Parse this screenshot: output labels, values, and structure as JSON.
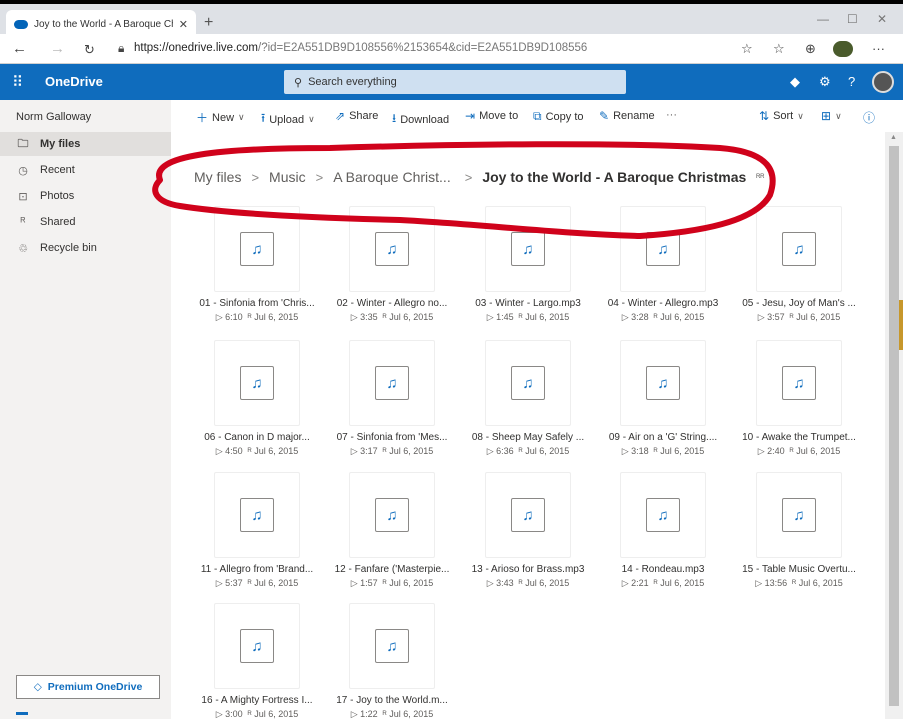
{
  "browser": {
    "tab_title": "Joy to the World - A Baroque Ch",
    "url_host": "https://onedrive.live.com",
    "url_rest": "/?id=E2A551DB9D108556%2153654&cid=E2A551DB9D108556"
  },
  "header": {
    "brand": "OneDrive",
    "search_placeholder": "Search everything"
  },
  "leftnav": {
    "user": "Norm Galloway",
    "items": [
      {
        "label": "My files",
        "icon": "folder-icon",
        "glyph": "🗀"
      },
      {
        "label": "Recent",
        "icon": "clock-icon",
        "glyph": "◷"
      },
      {
        "label": "Photos",
        "icon": "photo-icon",
        "glyph": "⊡"
      },
      {
        "label": "Shared",
        "icon": "people-icon",
        "glyph": "ᴿ"
      },
      {
        "label": "Recycle bin",
        "icon": "trash-icon",
        "glyph": "♲"
      }
    ],
    "premium": "Premium OneDrive"
  },
  "commands": {
    "new": "New",
    "upload": "Upload",
    "share": "Share",
    "download": "Download",
    "move_to": "Move to",
    "copy_to": "Copy to",
    "rename": "Rename",
    "more": "···",
    "sort": "Sort"
  },
  "breadcrumb": {
    "items": [
      "My files",
      "Music",
      "A Baroque Christ...",
      "Joy to the World - A Baroque Christmas"
    ]
  },
  "files": [
    {
      "name": "01 - Sinfonia from 'Chris...",
      "duration": "6:10",
      "date": "Jul 6, 2015"
    },
    {
      "name": "02 - Winter - Allegro no...",
      "duration": "3:35",
      "date": "Jul 6, 2015"
    },
    {
      "name": "03 - Winter - Largo.mp3",
      "duration": "1:45",
      "date": "Jul 6, 2015"
    },
    {
      "name": "04 - Winter - Allegro.mp3",
      "duration": "3:28",
      "date": "Jul 6, 2015"
    },
    {
      "name": "05 - Jesu, Joy of Man's ...",
      "duration": "3:57",
      "date": "Jul 6, 2015"
    },
    {
      "name": "06 - Canon in D major...",
      "duration": "4:50",
      "date": "Jul 6, 2015"
    },
    {
      "name": "07 - Sinfonia from 'Mes...",
      "duration": "3:17",
      "date": "Jul 6, 2015"
    },
    {
      "name": "08 - Sheep May Safely ...",
      "duration": "6:36",
      "date": "Jul 6, 2015"
    },
    {
      "name": "09 - Air on a 'G' String....",
      "duration": "3:18",
      "date": "Jul 6, 2015"
    },
    {
      "name": "10 - Awake the Trumpet...",
      "duration": "2:40",
      "date": "Jul 6, 2015"
    },
    {
      "name": "11 - Allegro from 'Brand...",
      "duration": "5:37",
      "date": "Jul 6, 2015"
    },
    {
      "name": "12 - Fanfare ('Masterpie...",
      "duration": "1:57",
      "date": "Jul 6, 2015"
    },
    {
      "name": "13 - Arioso for Brass.mp3",
      "duration": "3:43",
      "date": "Jul 6, 2015"
    },
    {
      "name": "14 - Rondeau.mp3",
      "duration": "2:21",
      "date": "Jul 6, 2015"
    },
    {
      "name": "15 - Table Music Overtu...",
      "duration": "13:56",
      "date": "Jul 6, 2015"
    },
    {
      "name": "16 - A Mighty Fortress I...",
      "duration": "3:00",
      "date": "Jul 6, 2015"
    },
    {
      "name": "17 - Joy to the World.m...",
      "duration": "1:22",
      "date": "Jul 6, 2015"
    }
  ],
  "colors": {
    "accent": "#0f6cbd",
    "annotation": "#d0021b"
  }
}
